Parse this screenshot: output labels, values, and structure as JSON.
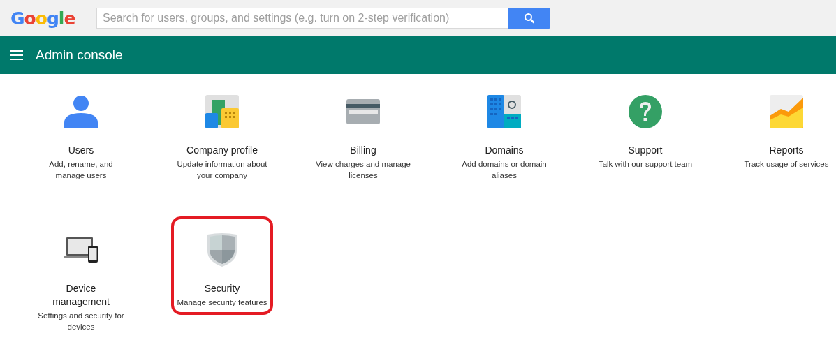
{
  "logo": "Google",
  "search": {
    "placeholder": "Search for users, groups, and settings (e.g. turn on 2-step verification)"
  },
  "app_bar": {
    "title": "Admin console"
  },
  "tiles": [
    {
      "title": "Users",
      "description": "Add, rename, and manage users",
      "highlighted": false
    },
    {
      "title": "Company profile",
      "description": "Update information about your company",
      "highlighted": false
    },
    {
      "title": "Billing",
      "description": "View charges and manage licenses",
      "highlighted": false
    },
    {
      "title": "Domains",
      "description": "Add domains or domain aliases",
      "highlighted": false
    },
    {
      "title": "Support",
      "description": "Talk with our support team",
      "highlighted": false
    },
    {
      "title": "Reports",
      "description": "Track usage of services",
      "highlighted": false
    },
    {
      "title": "Device management",
      "description": "Settings and security for devices",
      "highlighted": false
    },
    {
      "title": "Security",
      "description": "Manage security features",
      "highlighted": true
    }
  ]
}
